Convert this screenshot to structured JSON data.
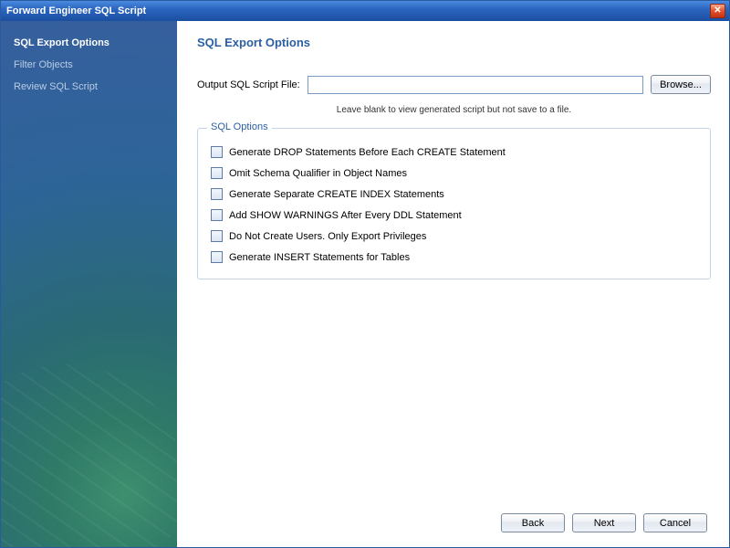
{
  "window": {
    "title": "Forward Engineer SQL Script"
  },
  "sidebar": {
    "steps": [
      {
        "label": "SQL Export Options",
        "active": true
      },
      {
        "label": "Filter Objects",
        "active": false
      },
      {
        "label": "Review SQL Script",
        "active": false
      }
    ]
  },
  "page": {
    "title": "SQL Export Options",
    "output_label": "Output SQL Script File:",
    "output_value": "",
    "browse_label": "Browse...",
    "hint": "Leave blank to view generated script but not save to a file.",
    "group_title": "SQL Options",
    "options": [
      {
        "label": "Generate DROP Statements Before Each CREATE Statement",
        "checked": false
      },
      {
        "label": "Omit Schema Qualifier in Object Names",
        "checked": false
      },
      {
        "label": "Generate Separate CREATE INDEX Statements",
        "checked": false
      },
      {
        "label": "Add SHOW WARNINGS After Every DDL Statement",
        "checked": false
      },
      {
        "label": "Do Not Create Users. Only Export Privileges",
        "checked": false
      },
      {
        "label": "Generate INSERT Statements for Tables",
        "checked": false
      }
    ]
  },
  "footer": {
    "back_label": "Back",
    "next_label": "Next",
    "cancel_label": "Cancel"
  }
}
